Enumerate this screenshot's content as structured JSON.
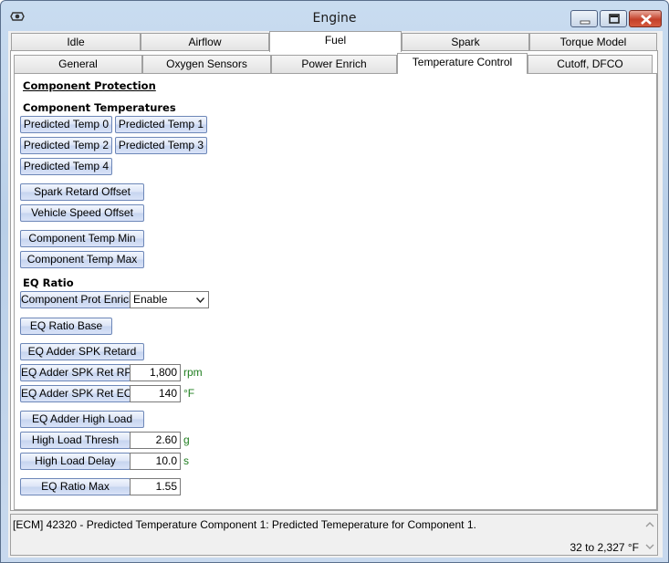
{
  "window": {
    "title": "Engine"
  },
  "main_tabs": [
    "Idle",
    "Airflow",
    "Fuel",
    "Spark",
    "Torque Model"
  ],
  "sub_tabs": [
    "General",
    "Oxygen Sensors",
    "Power Enrich",
    "Temperature Control",
    "Cutoff, DFCO"
  ],
  "content": {
    "section_title": "Component Protection",
    "temps_header": "Component Temperatures",
    "temp_buttons": [
      "Predicted Temp 0",
      "Predicted Temp 1",
      "Predicted Temp 2",
      "Predicted Temp 3",
      "Predicted Temp 4"
    ],
    "spark_retard_offset": "Spark Retard Offset",
    "vehicle_speed_offset": "Vehicle Speed Offset",
    "component_temp_min": "Component Temp Min",
    "component_temp_max": "Component Temp Max",
    "eq_ratio_header": "EQ Ratio",
    "comp_prot_enrich": {
      "label": "Component Prot Enrich",
      "value": "Enable"
    },
    "eq_ratio_base": "EQ Ratio Base",
    "eq_adder_spk_retard": "EQ Adder SPK Retard",
    "eq_adder_spk_ret_rpm": {
      "label": "EQ Adder SPK Ret RPM",
      "value": "1,800",
      "unit": "rpm"
    },
    "eq_adder_spk_ret_ect": {
      "label": "EQ Adder SPK Ret ECT",
      "value": "140",
      "unit": "°F"
    },
    "eq_adder_high_load": "EQ Adder High Load",
    "high_load_thresh": {
      "label": "High Load Thresh",
      "value": "2.60",
      "unit": "g"
    },
    "high_load_delay": {
      "label": "High Load Delay",
      "value": "10.0",
      "unit": "s"
    },
    "eq_ratio_max": {
      "label": "EQ Ratio Max",
      "value": "1.55"
    }
  },
  "status": {
    "message": "[ECM] 42320 - Predicted Temperature Component 1: Predicted Temeperature for Component 1.",
    "range": "32 to 2,327 °F"
  }
}
